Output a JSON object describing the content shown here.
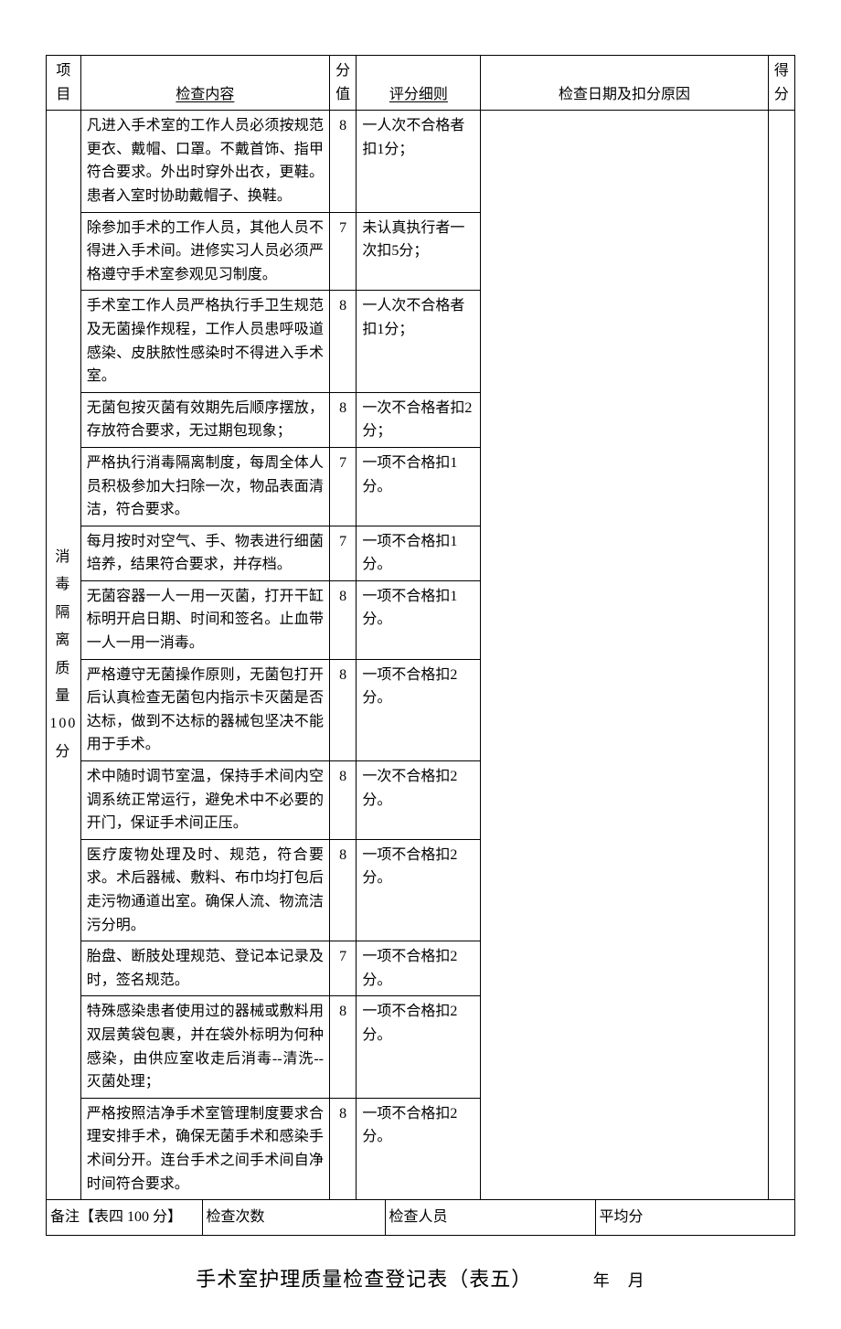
{
  "headers": {
    "project": "项目",
    "content": "检查内容",
    "score": "分值",
    "rule": "评分细则",
    "date_reason": "检查日期及扣分原因",
    "actual": "得分"
  },
  "project_label": "消毒隔离质量100分",
  "rows": [
    {
      "content": "凡进入手术室的工作人员必须按规范更衣、戴帽、口罩。不戴首饰、指甲符合要求。外出时穿外出衣，更鞋。患者入室时协助戴帽子、换鞋。",
      "score": "8",
      "rule": "一人次不合格者扣1分；"
    },
    {
      "content": "除参加手术的工作人员，其他人员不得进入手术间。进修实习人员必须严格遵守手术室参观见习制度。",
      "score": "7",
      "rule": "未认真执行者一次扣5分；"
    },
    {
      "content": "手术室工作人员严格执行手卫生规范及无菌操作规程，工作人员患呼吸道感染、皮肤脓性感染时不得进入手术室。",
      "score": "8",
      "rule": "一人次不合格者扣1分；"
    },
    {
      "content": "无菌包按灭菌有效期先后顺序摆放，存放符合要求，无过期包现象；",
      "score": "8",
      "rule": "一次不合格者扣2分；"
    },
    {
      "content": "严格执行消毒隔离制度，每周全体人员积极参加大扫除一次，物品表面清洁，符合要求。",
      "score": "7",
      "rule": "一项不合格扣1分。"
    },
    {
      "content": "每月按时对空气、手、物表进行细菌培养，结果符合要求，并存档。",
      "score": "7",
      "rule": "一项不合格扣1分。"
    },
    {
      "content": "无菌容器一人一用一灭菌，打开干缸标明开启日期、时间和签名。止血带一人一用一消毒。",
      "score": "8",
      "rule": "一项不合格扣1分。"
    },
    {
      "content": "严格遵守无菌操作原则，无菌包打开后认真检查无菌包内指示卡灭菌是否达标，做到不达标的器械包坚决不能用于手术。",
      "score": "8",
      "rule": "一项不合格扣2分。"
    },
    {
      "content": "术中随时调节室温，保持手术间内空调系统正常运行，避免术中不必要的开门，保证手术间正压。",
      "score": "8",
      "rule": "一次不合格扣2分。"
    },
    {
      "content": "医疗废物处理及时、规范，符合要求。术后器械、敷料、布巾均打包后走污物通道出室。确保人流、物流洁污分明。",
      "score": "8",
      "rule": "一项不合格扣2分。"
    },
    {
      "content": "胎盘、断肢处理规范、登记本记录及时，签名规范。",
      "score": "7",
      "rule": "一项不合格扣2分。"
    },
    {
      "content": "特殊感染患者使用过的器械或敷料用双层黄袋包裹，并在袋外标明为何种感染，由供应室收走后消毒--清洗--灭菌处理；",
      "score": "8",
      "rule": "一项不合格扣2分。"
    },
    {
      "content": "严格按照洁净手术室管理制度要求合理安排手术，确保无菌手术和感染手术间分开。连台手术之间手术间自净时间符合要求。",
      "score": "8",
      "rule": "一项不合格扣2分。"
    }
  ],
  "footer": {
    "note": "备注【表四 100 分】",
    "check_count_label": "检查次数",
    "checker_label": "检查人员",
    "avg_label": "平均分"
  },
  "next_title": "手术室护理质量检查登记表（表五）",
  "next_date": "年　月"
}
